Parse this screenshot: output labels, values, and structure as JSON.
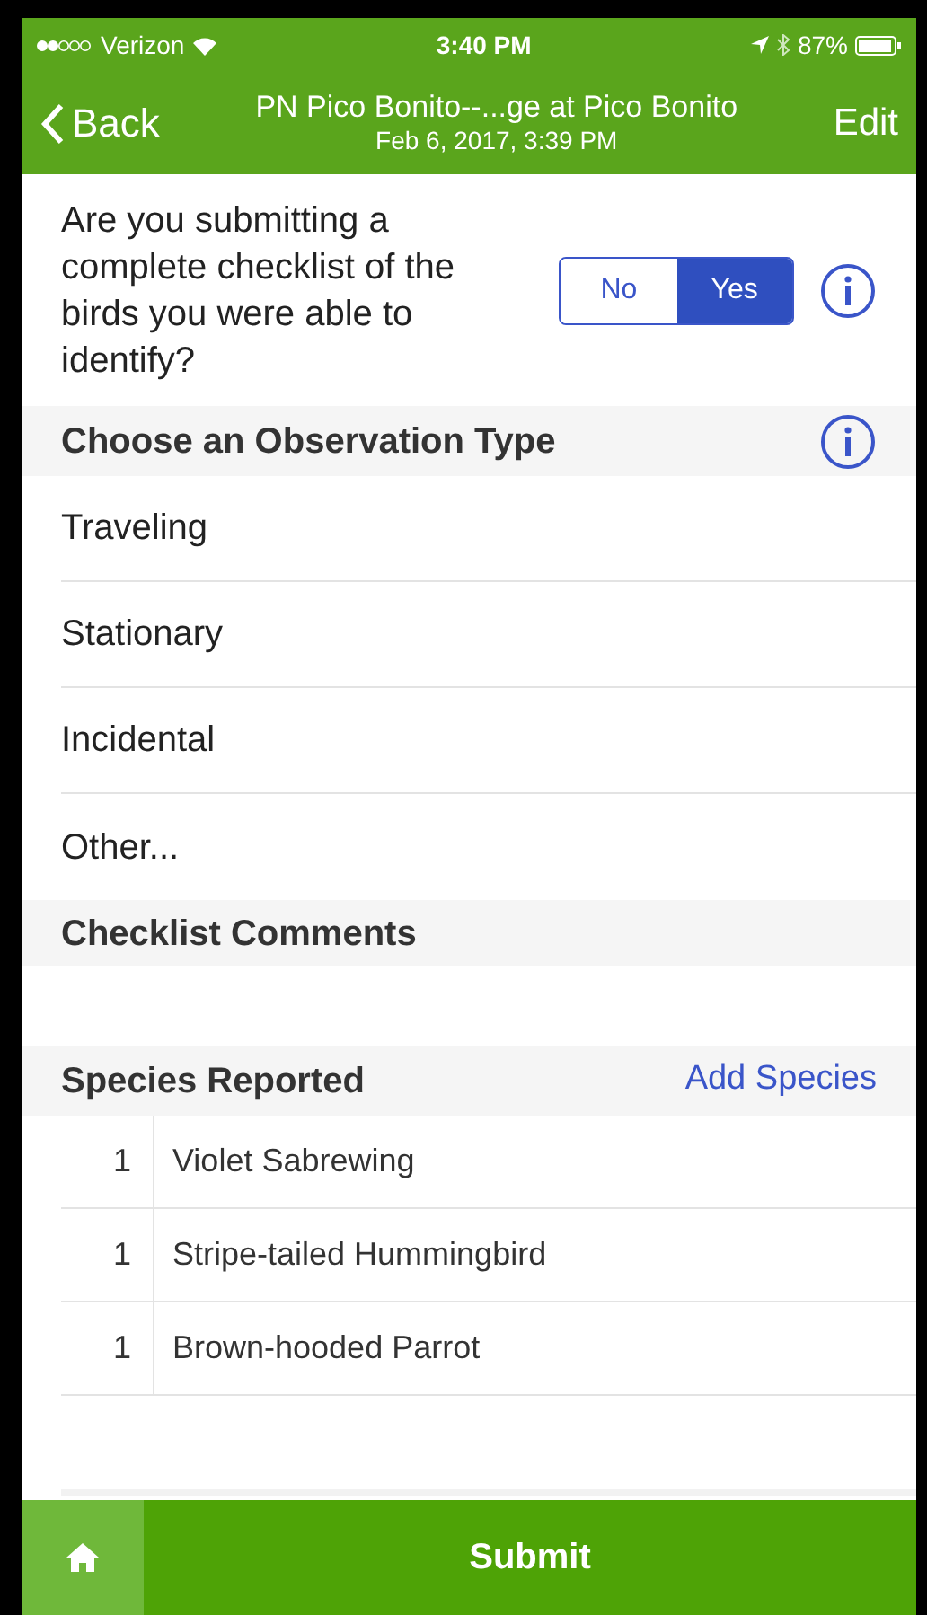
{
  "status_bar": {
    "carrier": "Verizon",
    "time": "3:40 PM",
    "battery": "87%"
  },
  "nav": {
    "back": "Back",
    "title": "PN Pico Bonito--...ge at Pico Bonito",
    "subtitle": "Feb 6, 2017, 3:39 PM",
    "action": "Edit"
  },
  "complete_question": {
    "text": "Are you submitting a complete checklist of the birds you were able to identify?",
    "options": [
      {
        "label": "No",
        "selected": false
      },
      {
        "label": "Yes",
        "selected": true
      }
    ]
  },
  "observation_type": {
    "header": "Choose an Observation Type",
    "items": [
      "Traveling",
      "Stationary",
      "Incidental",
      "Other..."
    ]
  },
  "comments": {
    "header": "Checklist Comments"
  },
  "species": {
    "header": "Species Reported",
    "action": "Add Species",
    "rows": [
      {
        "count": "1",
        "name": "Violet Sabrewing"
      },
      {
        "count": "1",
        "name": "Stripe-tailed Hummingbird"
      },
      {
        "count": "1",
        "name": "Brown-hooded Parrot"
      }
    ]
  },
  "footer": {
    "submit": "Submit"
  }
}
